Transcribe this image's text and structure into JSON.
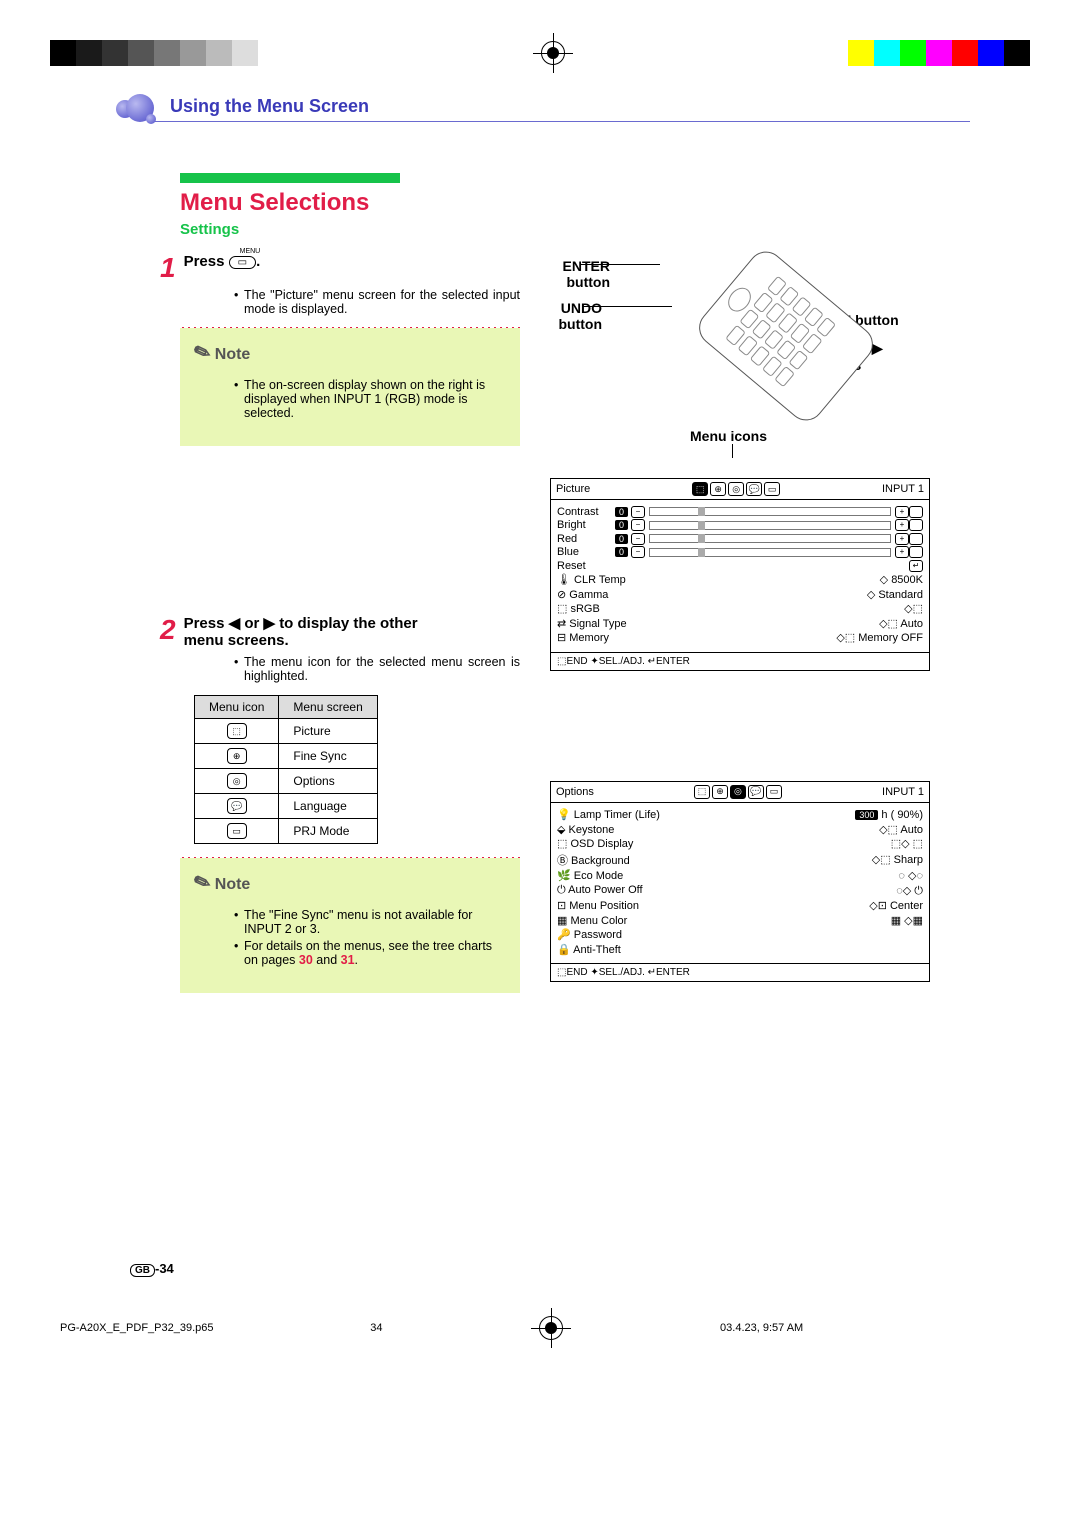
{
  "chapter": "Using the Menu Screen",
  "title": "Menu Selections",
  "subtitle": "Settings",
  "step1": {
    "head_prefix": "Press ",
    "menu_label": "MENU",
    "period": ".",
    "body_item": "The \"Picture\" menu screen for the selected input mode is displayed."
  },
  "note1": {
    "title": "Note",
    "body_item": "The on-screen display shown on the right is displayed when INPUT 1 (RGB) mode is selected."
  },
  "step2": {
    "head_line1": "Press ◀ or ▶ to display the other",
    "head_line2": "menu screens.",
    "body_item": "The menu icon for the selected menu screen is highlighted."
  },
  "menu_table": {
    "col1": "Menu icon",
    "col2": "Menu screen",
    "rows": [
      {
        "icon": "⬚",
        "name": "Picture"
      },
      {
        "icon": "⊕",
        "name": "Fine Sync"
      },
      {
        "icon": "◎",
        "name": "Options"
      },
      {
        "icon": "💬",
        "name": "Language"
      },
      {
        "icon": "▭",
        "name": "PRJ Mode"
      }
    ]
  },
  "note2": {
    "title": "Note",
    "item1": "The \"Fine Sync\" menu is not available for INPUT 2 or 3.",
    "item2_pre": "For details on the menus, see the tree charts on pages ",
    "item2_pg1": "30",
    "item2_mid": " and ",
    "item2_pg2": "31",
    "item2_suf": "."
  },
  "right_labels": {
    "enter": "ENTER button",
    "undo": "UNDO button",
    "menu": "MENU button",
    "arrows": "▲, ▼, ◀, ▶ buttons",
    "menu_icons": "Menu icons"
  },
  "osd_picture": {
    "head": "Picture",
    "input": "INPUT  1",
    "rows_sliders": [
      "Contrast",
      "Bright",
      "Red",
      "Blue"
    ],
    "reset": "Reset",
    "clr_temp": {
      "label": "CLR Temp",
      "val": "8500K"
    },
    "gamma": {
      "label": "Gamma",
      "val": "Standard"
    },
    "srgb": "sRGB",
    "signal": {
      "label": "Signal Type",
      "val": "Auto"
    },
    "memory": {
      "label": "Memory",
      "val": "Memory OFF"
    },
    "footer": "⬚END ✦SEL./ADJ. ↵ENTER"
  },
  "osd_options": {
    "head": "Options",
    "input": "INPUT  1",
    "lamp": {
      "label": "Lamp Timer (Life)",
      "hours": "300",
      "suffix": "h (     90%)"
    },
    "keystone": {
      "label": "Keystone",
      "val": "Auto"
    },
    "osd": "OSD Display",
    "bg": {
      "label": "Background",
      "val": "Sharp"
    },
    "eco": "Eco Mode",
    "apo": "Auto Power Off",
    "mpos": {
      "label": "Menu Position",
      "val": "Center"
    },
    "mcol": "Menu Color",
    "pwd": "Password",
    "anti": "Anti-Theft",
    "footer": "⬚END ✦SEL./ADJ. ↵ENTER"
  },
  "page_num_prefix": "GB",
  "page_num": "-34",
  "footer": {
    "file": "PG-A20X_E_PDF_P32_39.p65",
    "pg": "34",
    "date": "03.4.23, 9:57 AM"
  },
  "colors": {
    "grays": [
      "#000",
      "#1a1a1a",
      "#333",
      "#555",
      "#777",
      "#999",
      "#bbb",
      "#ddd",
      "#fff"
    ],
    "crop": [
      "#fff",
      "#ff0",
      "#0ff",
      "#0f0",
      "#f0f",
      "#f00",
      "#00f",
      "#000"
    ]
  }
}
